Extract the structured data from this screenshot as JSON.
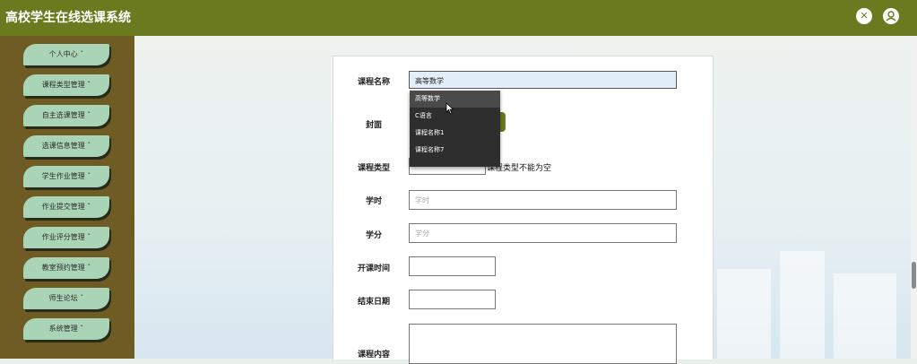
{
  "app": {
    "title": "高校学生在线选课系统"
  },
  "header": {
    "icons": [
      "fullscreen-icon",
      "user-icon"
    ]
  },
  "sidebar": {
    "items": [
      {
        "label": "个人中心"
      },
      {
        "label": "课程类型管理"
      },
      {
        "label": "自主选课管理"
      },
      {
        "label": "选课信息管理"
      },
      {
        "label": "学生作业管理"
      },
      {
        "label": "作业提交管理"
      },
      {
        "label": "作业评分管理"
      },
      {
        "label": "教室预约管理"
      },
      {
        "label": "师生论坛"
      },
      {
        "label": "系统管理"
      }
    ]
  },
  "form": {
    "course_name": {
      "label": "课程名称",
      "value": "高等数学"
    },
    "cover": {
      "label": "封面"
    },
    "course_type": {
      "label": "课程类型",
      "error": "课程类型不能为空"
    },
    "hours": {
      "label": "学时",
      "placeholder": "学时"
    },
    "credits": {
      "label": "学分",
      "placeholder": "学分"
    },
    "start_time": {
      "label": "开课时间"
    },
    "end_date": {
      "label": "结束日期"
    },
    "content": {
      "label": "课程内容"
    }
  },
  "autocomplete": {
    "options": [
      "高等数学",
      "C语言",
      "课程名称1",
      "课程名称7"
    ],
    "highlighted_index": 0
  },
  "colors": {
    "topbar": "#6b7a1f",
    "sidebar": "#6f5c24",
    "menu_item": "#a9d4b6"
  }
}
